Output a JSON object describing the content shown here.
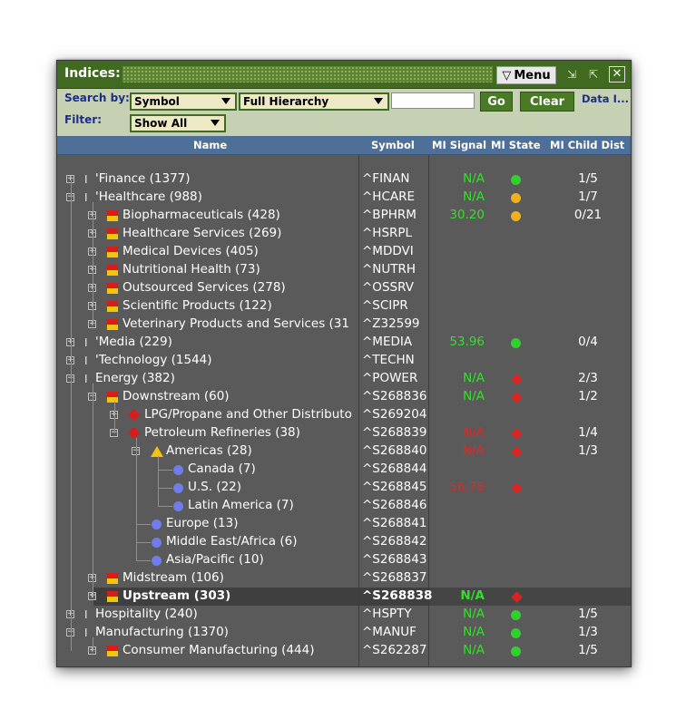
{
  "window": {
    "title": "Indices:",
    "menu_label": "Menu"
  },
  "toolbar": {
    "search_by_label": "Search by:",
    "filter_label": "Filter:",
    "symbol_combo": "Symbol",
    "hierarchy_combo": "Full Hierarchy",
    "filter_combo": "Show All",
    "search_value": "",
    "go_label": "Go",
    "clear_label": "Clear",
    "data_label": "Data I..."
  },
  "columns": {
    "name": "Name",
    "symbol": "Symbol",
    "mi_signal": "MI Signal",
    "mi_state": "MI State",
    "mi_child_dist": "MI Child Dist"
  },
  "colors": {
    "title_bar": "#3f6a1f",
    "toolbar": "#c6d0b2",
    "header": "#4e6f97",
    "grid_bg": "#5a5a5a",
    "signal_green": "#34e02a",
    "signal_red": "#dd2a2a",
    "state_yellow": "#f2b01a"
  },
  "rows": [
    {
      "name": "'Finance (1377)",
      "symbol": "^FINAN",
      "signal": "N/A",
      "signal_color": "green",
      "state": "green",
      "dist": "1/5",
      "level": 0,
      "icon": "cursor-icon",
      "toggle": "plus"
    },
    {
      "name": "'Healthcare (988)",
      "symbol": "^HCARE",
      "signal": "N/A",
      "signal_color": "green",
      "state": "yellow",
      "dist": "1/7",
      "level": 0,
      "icon": "cursor-icon",
      "toggle": "minus"
    },
    {
      "name": "Biopharmaceuticals (428)",
      "symbol": "^BPHRM",
      "signal": "30.20",
      "signal_color": "green",
      "state": "yellow",
      "dist": "0/21",
      "level": 1,
      "icon": "industry-icon",
      "toggle": "plus"
    },
    {
      "name": "Healthcare Services (269)",
      "symbol": "^HSRPL",
      "signal": "",
      "signal_color": "",
      "state": "",
      "dist": "",
      "level": 1,
      "icon": "industry-icon",
      "toggle": "plus"
    },
    {
      "name": "Medical Devices (405)",
      "symbol": "^MDDVI",
      "signal": "",
      "signal_color": "",
      "state": "",
      "dist": "",
      "level": 1,
      "icon": "industry-icon",
      "toggle": "plus"
    },
    {
      "name": "Nutritional Health (73)",
      "symbol": "^NUTRH",
      "signal": "",
      "signal_color": "",
      "state": "",
      "dist": "",
      "level": 1,
      "icon": "industry-icon",
      "toggle": "plus"
    },
    {
      "name": "Outsourced Services (278)",
      "symbol": "^OSSRV",
      "signal": "",
      "signal_color": "",
      "state": "",
      "dist": "",
      "level": 1,
      "icon": "industry-icon",
      "toggle": "plus"
    },
    {
      "name": "Scientific Products (122)",
      "symbol": "^SCIPR",
      "signal": "",
      "signal_color": "",
      "state": "",
      "dist": "",
      "level": 1,
      "icon": "industry-icon",
      "toggle": "plus"
    },
    {
      "name": "Veterinary Products and Services (31",
      "symbol": "^Z32599",
      "signal": "",
      "signal_color": "",
      "state": "",
      "dist": "",
      "level": 1,
      "icon": "industry-icon",
      "toggle": "plus"
    },
    {
      "name": "'Media (229)",
      "symbol": "^MEDIA",
      "signal": "53.96",
      "signal_color": "green",
      "state": "green",
      "dist": "0/4",
      "level": 0,
      "icon": "cursor-icon",
      "toggle": "plus"
    },
    {
      "name": "'Technology (1544)",
      "symbol": "^TECHN",
      "signal": "",
      "signal_color": "",
      "state": "",
      "dist": "",
      "level": 0,
      "icon": "cursor-icon",
      "toggle": "plus"
    },
    {
      "name": "Energy (382)",
      "symbol": "^POWER",
      "signal": "N/A",
      "signal_color": "green",
      "state": "red",
      "dist": "2/3",
      "level": 0,
      "icon": "cursor-icon",
      "toggle": "minus"
    },
    {
      "name": "Downstream (60)",
      "symbol": "^S268836",
      "signal": "N/A",
      "signal_color": "green",
      "state": "red",
      "dist": "1/2",
      "level": 1,
      "icon": "industry-icon",
      "toggle": "minus"
    },
    {
      "name": "LPG/Propane and Other Distributo",
      "symbol": "^S269204",
      "signal": "",
      "signal_color": "",
      "state": "",
      "dist": "",
      "level": 2,
      "icon": "diamond-icon",
      "toggle": "plus"
    },
    {
      "name": "Petroleum Refineries (38)",
      "symbol": "^S268839",
      "signal": "N/A",
      "signal_color": "red",
      "state": "red",
      "dist": "1/4",
      "level": 2,
      "icon": "diamond-icon",
      "toggle": "minus"
    },
    {
      "name": "Americas (28)",
      "symbol": "^S268840",
      "signal": "N/A",
      "signal_color": "red",
      "state": "red",
      "dist": "1/3",
      "level": 3,
      "icon": "triangle-icon",
      "toggle": "minus"
    },
    {
      "name": "Canada (7)",
      "symbol": "^S268844",
      "signal": "",
      "signal_color": "",
      "state": "",
      "dist": "",
      "level": 4,
      "icon": "circle-icon",
      "toggle": ""
    },
    {
      "name": "U.S. (22)",
      "symbol": "^S268845",
      "signal": "56.78",
      "signal_color": "red",
      "state": "red",
      "dist": "",
      "level": 4,
      "icon": "circle-icon",
      "toggle": ""
    },
    {
      "name": "Latin America (7)",
      "symbol": "^S268846",
      "signal": "",
      "signal_color": "",
      "state": "",
      "dist": "",
      "level": 4,
      "icon": "circle-icon",
      "toggle": ""
    },
    {
      "name": "Europe (13)",
      "symbol": "^S268841",
      "signal": "",
      "signal_color": "",
      "state": "",
      "dist": "",
      "level": 3,
      "icon": "circle-icon",
      "toggle": ""
    },
    {
      "name": "Middle East/Africa (6)",
      "symbol": "^S268842",
      "signal": "",
      "signal_color": "",
      "state": "",
      "dist": "",
      "level": 3,
      "icon": "circle-icon",
      "toggle": ""
    },
    {
      "name": "Asia/Pacific (10)",
      "symbol": "^S268843",
      "signal": "",
      "signal_color": "",
      "state": "",
      "dist": "",
      "level": 3,
      "icon": "circle-icon",
      "toggle": ""
    },
    {
      "name": "Midstream (106)",
      "symbol": "^S268837",
      "signal": "",
      "signal_color": "",
      "state": "",
      "dist": "",
      "level": 1,
      "icon": "industry-icon",
      "toggle": "plus"
    },
    {
      "name": "Upstream (303)",
      "symbol": "^S268838",
      "signal": "N/A",
      "signal_color": "green",
      "state": "red",
      "dist": "",
      "level": 1,
      "icon": "industry-icon",
      "toggle": "plus",
      "selected": true
    },
    {
      "name": "Hospitality (240)",
      "symbol": "^HSPTY",
      "signal": "N/A",
      "signal_color": "green",
      "state": "green",
      "dist": "1/5",
      "level": 0,
      "icon": "cursor-icon",
      "toggle": "plus"
    },
    {
      "name": "Manufacturing (1370)",
      "symbol": "^MANUF",
      "signal": "N/A",
      "signal_color": "green",
      "state": "green",
      "dist": "1/3",
      "level": 0,
      "icon": "cursor-icon",
      "toggle": "minus"
    },
    {
      "name": "Consumer Manufacturing (444)",
      "symbol": "^S262287",
      "signal": "N/A",
      "signal_color": "green",
      "state": "green",
      "dist": "1/5",
      "level": 1,
      "icon": "industry-icon",
      "toggle": "plus"
    }
  ]
}
